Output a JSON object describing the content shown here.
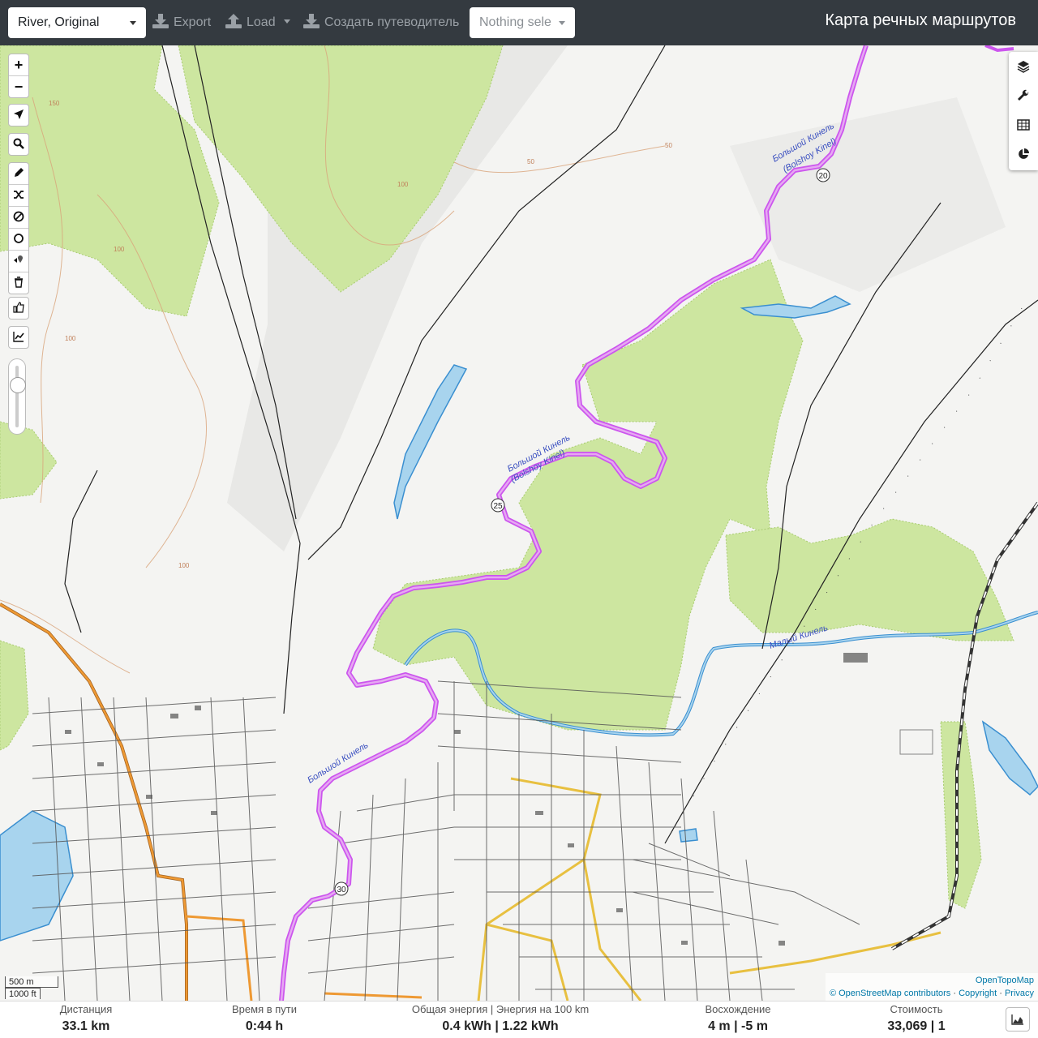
{
  "topbar": {
    "profile_select": "River, Original",
    "export_label": "Export",
    "load_label": "Load",
    "guide_label": "Создать путеводитель",
    "nothing_selected": "Nothing sele",
    "app_title": "Карта речных маршрутов"
  },
  "map_controls": {
    "zoom_in": "+",
    "zoom_out": "−"
  },
  "map": {
    "river_main_name": "Большой Кинель",
    "river_main_name_latin": "(Bolshoy Kinel)",
    "river_small_name": "Малый Кинель",
    "contour_labels": [
      "50",
      "50",
      "100",
      "150",
      "100",
      "100",
      "100"
    ],
    "km_markers": [
      "20",
      "25",
      "30"
    ],
    "colors": {
      "route": "#cc55ee",
      "route_core": "#e080f0",
      "forest": "#cde6a0",
      "water": "#a8d4ee",
      "water_stroke": "#3a8fd0",
      "main_road": "#ee9933",
      "secondary_road": "#e8c040",
      "contour": "#d9a47a"
    }
  },
  "scale": {
    "metric": "500 m",
    "imperial": "1000 ft"
  },
  "attribution": {
    "top": "OpenTopoMap",
    "osm": "© OpenStreetMap contributors",
    "copyright": "Copyright",
    "privacy": "Privacy"
  },
  "stats": {
    "distance_label": "Дистанция",
    "distance_value": "33.1 km",
    "time_label": "Время в пути",
    "time_value": "0:44 h",
    "energy_label": "Общая энергия | Энергия на 100 km",
    "energy_value": "0.4 kWh | 1.22 kWh",
    "ascent_label": "Восхождение",
    "ascent_value": "4 m | -5 m",
    "cost_label": "Стоимость",
    "cost_value": "33,069 | 1"
  }
}
